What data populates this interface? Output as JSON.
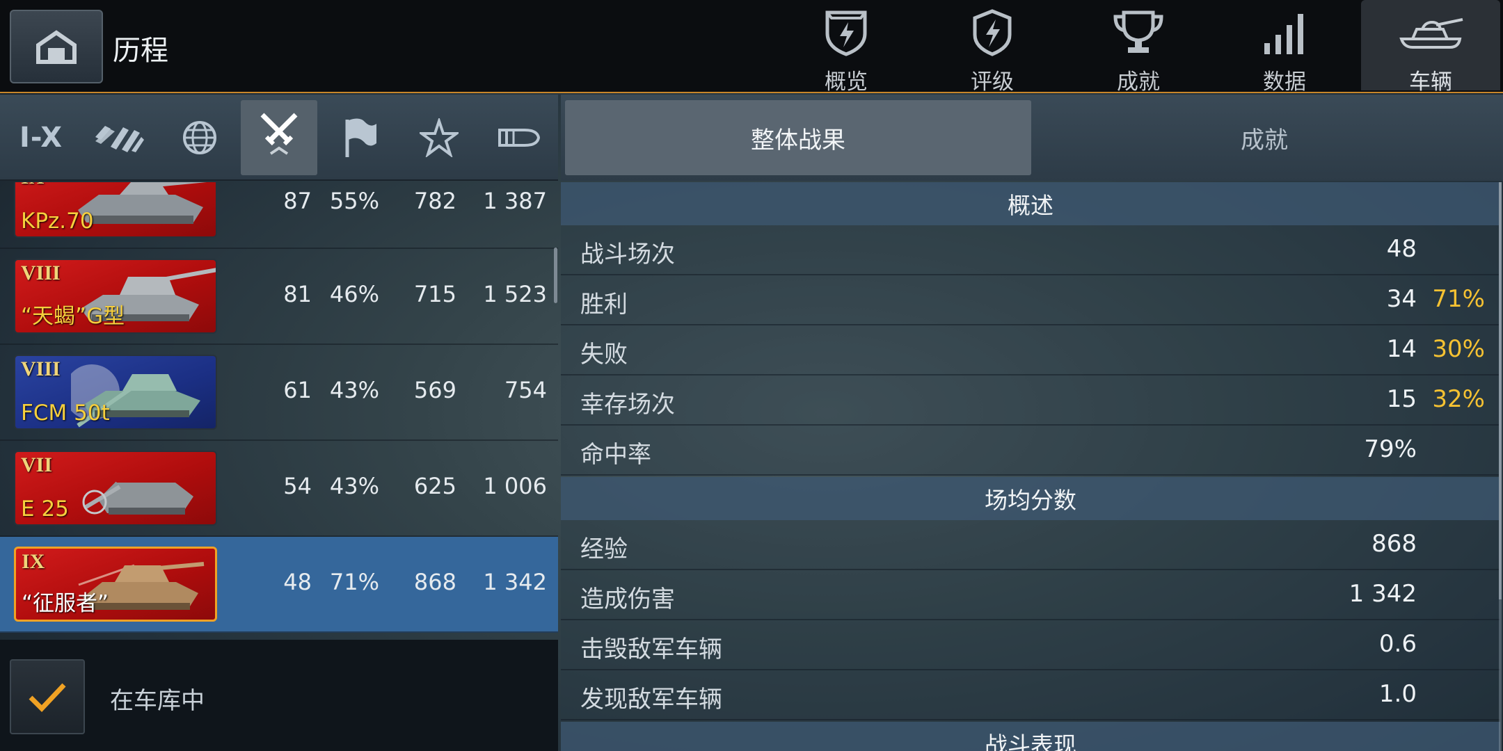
{
  "header": {
    "title": "历程",
    "tabs": [
      {
        "label": "概览",
        "icon": "shield-lightning-icon"
      },
      {
        "label": "评级",
        "icon": "badge-lightning-icon"
      },
      {
        "label": "成就",
        "icon": "trophy-icon"
      },
      {
        "label": "数据",
        "icon": "bar-signal-icon"
      },
      {
        "label": "车辆",
        "icon": "tank-icon",
        "active": true
      }
    ]
  },
  "filters": {
    "tier_label": "I-X",
    "items": [
      "tier-filter",
      "type-filter",
      "nation-filter",
      "battles-sort",
      "winrate-sort",
      "xp-sort",
      "damage-sort"
    ],
    "active": "battles-sort"
  },
  "subtabs": {
    "overall": "整体战果",
    "achievements": "成就"
  },
  "vehicles": [
    {
      "tier": "IX",
      "name": "KPz.70",
      "battles": "87",
      "winrate": "55%",
      "xp": "782",
      "damage": "1 387",
      "flag": "red"
    },
    {
      "tier": "VIII",
      "name": "“天蝎”G型",
      "battles": "81",
      "winrate": "46%",
      "xp": "715",
      "damage": "1 523",
      "flag": "red"
    },
    {
      "tier": "VIII",
      "name": "FCM 50t",
      "battles": "61",
      "winrate": "43%",
      "xp": "569",
      "damage": "754",
      "flag": "blue"
    },
    {
      "tier": "VII",
      "name": "E 25",
      "battles": "54",
      "winrate": "43%",
      "xp": "625",
      "damage": "1 006",
      "flag": "red"
    },
    {
      "tier": "IX",
      "name": "“征服者”",
      "battles": "48",
      "winrate": "71%",
      "xp": "868",
      "damage": "1 342",
      "flag": "red",
      "selected": true
    }
  ],
  "garage_filter": {
    "label": "在车库中",
    "checked": true
  },
  "stats": {
    "summary_title": "概述",
    "summary": [
      {
        "label": "战斗场次",
        "value": "48",
        "pct": ""
      },
      {
        "label": "胜利",
        "value": "34",
        "pct": "71%"
      },
      {
        "label": "失败",
        "value": "14",
        "pct": "30%"
      },
      {
        "label": "幸存场次",
        "value": "15",
        "pct": "32%"
      },
      {
        "label": "命中率",
        "value": "79%",
        "pct": ""
      }
    ],
    "avg_title": "场均分数",
    "avg": [
      {
        "label": "经验",
        "value": "868"
      },
      {
        "label": "造成伤害",
        "value": "1 342"
      },
      {
        "label": "击毁敌军车辆",
        "value": "0.6"
      },
      {
        "label": "发现敌军车辆",
        "value": "1.0"
      }
    ],
    "perf_title": "战斗表现"
  },
  "colors": {
    "accent": "#f0a224",
    "highlight_pct": "#f6c232",
    "selected_row": "#35679b"
  }
}
